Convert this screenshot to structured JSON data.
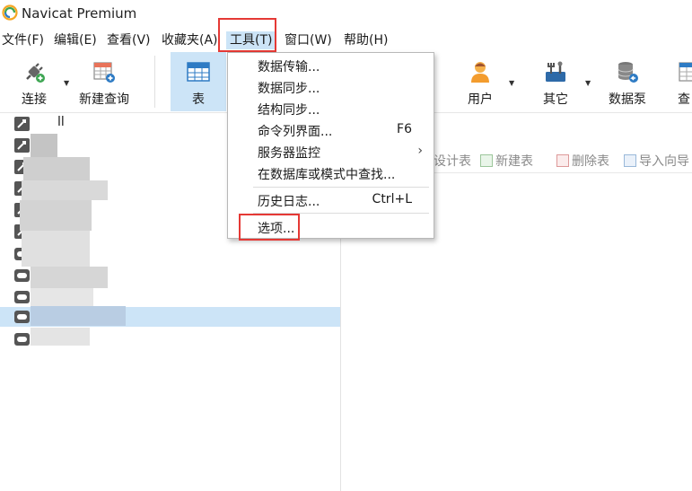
{
  "window": {
    "title": "Navicat Premium"
  },
  "menubar": {
    "items": [
      {
        "label": "文件(F)"
      },
      {
        "label": "编辑(E)"
      },
      {
        "label": "查看(V)"
      },
      {
        "label": "收藏夹(A)"
      },
      {
        "label": "工具(T)"
      },
      {
        "label": "窗口(W)"
      },
      {
        "label": "帮助(H)"
      }
    ]
  },
  "toolbar": {
    "connect": "连接",
    "new_query": "新建查询",
    "table": "表",
    "user": "用户",
    "other": "其它",
    "data_pump": "数据泵",
    "query_partial": "查"
  },
  "tools_menu": {
    "items": [
      {
        "label": "数据传输..."
      },
      {
        "label": "数据同步..."
      },
      {
        "label": "结构同步..."
      },
      {
        "label": "命令列界面...",
        "shortcut": "F6"
      },
      {
        "label": "服务器监控",
        "submenu": true
      },
      {
        "label": "在数据库或模式中查找..."
      },
      {
        "label": "历史日志...",
        "shortcut": "Ctrl+L"
      },
      {
        "label": "选项..."
      }
    ],
    "submenu_arrow": "›"
  },
  "tree": {
    "first_label_fragment": "ll"
  },
  "object_bar": {
    "design_table": "设计表",
    "new_table": "新建表",
    "delete_table": "删除表",
    "import_wizard": "导入向导"
  },
  "colors": {
    "highlight": "#cce4f7",
    "annotation_red": "#e53935",
    "icon_blue": "#2e7bc4"
  }
}
